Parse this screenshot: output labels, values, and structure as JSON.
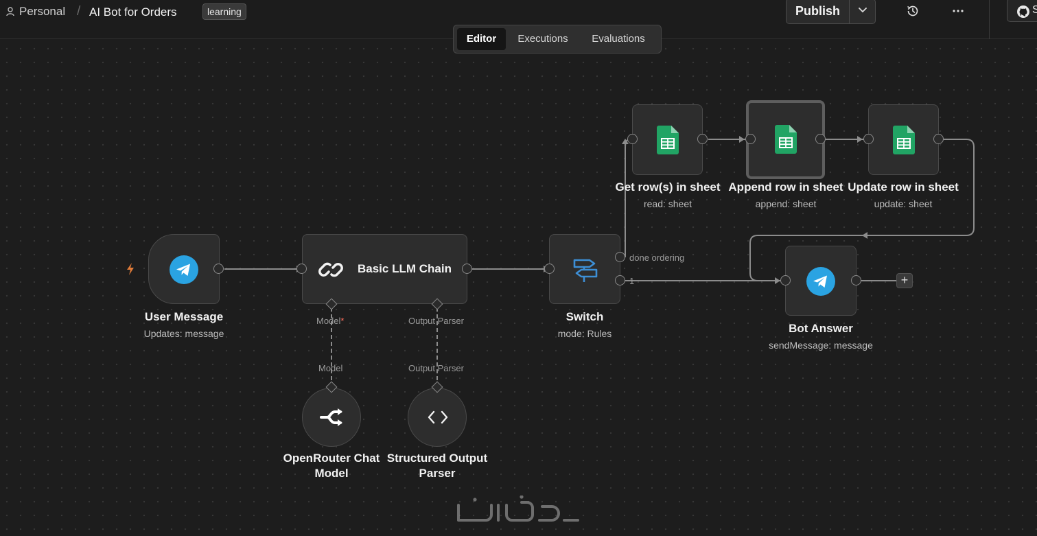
{
  "header": {
    "project": "Personal",
    "workflow_name": "AI Bot for Orders",
    "tag": "learning",
    "publish_label": "Publish",
    "github_label": "S"
  },
  "tabs": [
    {
      "label": "Editor",
      "active": true
    },
    {
      "label": "Executions",
      "active": false
    },
    {
      "label": "Evaluations",
      "active": false
    }
  ],
  "nodes": {
    "user_message": {
      "title": "User Message",
      "subtitle": "Updates: message",
      "icon": "telegram-icon"
    },
    "basic_llm_chain": {
      "title": "Basic LLM Chain",
      "icon": "link-icon",
      "ports": {
        "model": "Model",
        "output_parser": "Output Parser"
      }
    },
    "openrouter": {
      "title_line1": "OpenRouter Chat",
      "title_line2": "Model",
      "port": "Model",
      "icon": "openrouter-icon"
    },
    "structured_parser": {
      "title_line1": "Structured Output",
      "title_line2": "Parser",
      "port": "Output Parser",
      "icon": "code-brackets-icon"
    },
    "switch": {
      "title": "Switch",
      "subtitle": "mode: Rules",
      "icon": "signpost-icon",
      "outputs": [
        "done ordering",
        "1"
      ]
    },
    "get_rows": {
      "title": "Get row(s) in sheet",
      "subtitle": "read: sheet",
      "icon": "google-sheets-icon"
    },
    "append_row": {
      "title": "Append row in sheet",
      "subtitle": "append: sheet",
      "icon": "google-sheets-icon"
    },
    "update_row": {
      "title": "Update row in sheet",
      "subtitle": "update: sheet",
      "icon": "google-sheets-icon"
    },
    "bot_answer": {
      "title": "Bot Answer",
      "subtitle": "sendMessage: message",
      "icon": "telegram-icon"
    }
  },
  "required_marker": "*",
  "add_node_label": "+",
  "colors": {
    "background": "#1d1d1d",
    "node": "#2d2d2d",
    "telegram": "#2aa3e2",
    "sheets": "#21a464",
    "switch": "#3d8fd6",
    "trigger_bolt": "#e07b39",
    "required": "#ff6d5a"
  }
}
